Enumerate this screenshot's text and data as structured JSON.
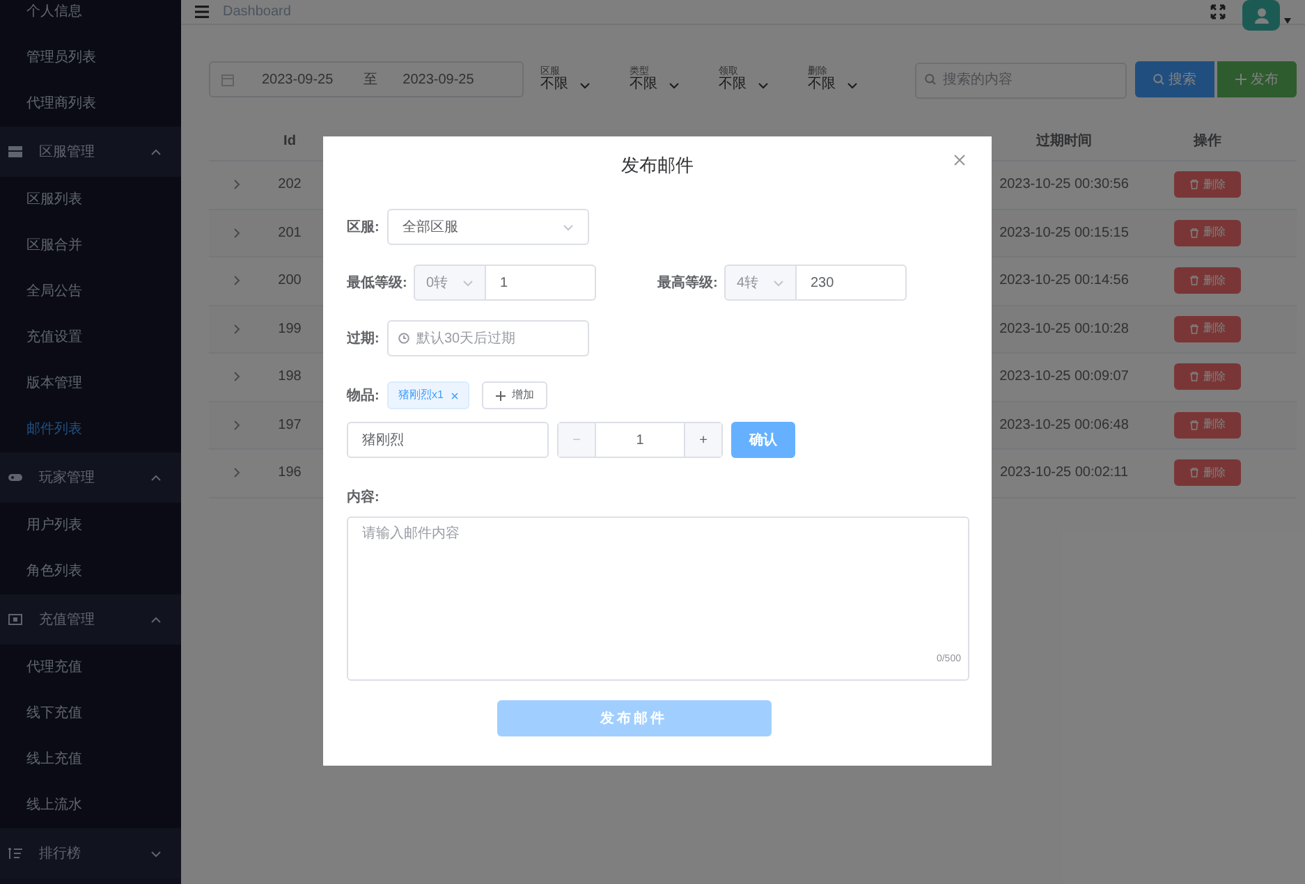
{
  "sidebar": {
    "entries": [
      {
        "kind": "item",
        "label": "个人信息",
        "selected": false
      },
      {
        "kind": "item",
        "label": "管理员列表",
        "selected": false
      },
      {
        "kind": "item",
        "label": "代理商列表",
        "selected": false
      },
      {
        "kind": "group",
        "label": "区服管理",
        "expanded": true,
        "children": [
          {
            "label": "区服列表",
            "selected": false
          },
          {
            "label": "区服合并",
            "selected": false
          },
          {
            "label": "全局公告",
            "selected": false
          },
          {
            "label": "充值设置",
            "selected": false
          },
          {
            "label": "版本管理",
            "selected": false
          },
          {
            "label": "邮件列表",
            "selected": true
          }
        ]
      },
      {
        "kind": "group",
        "label": "玩家管理",
        "expanded": true,
        "children": [
          {
            "label": "用户列表",
            "selected": false
          },
          {
            "label": "角色列表",
            "selected": false
          }
        ]
      },
      {
        "kind": "group",
        "label": "充值管理",
        "expanded": true,
        "children": [
          {
            "label": "代理充值",
            "selected": false
          },
          {
            "label": "线下充值",
            "selected": false
          },
          {
            "label": "线上充值",
            "selected": false
          },
          {
            "label": "线上流水",
            "selected": false
          }
        ]
      },
      {
        "kind": "group",
        "label": "排行榜",
        "expanded": false
      }
    ]
  },
  "header": {
    "breadcrumb": "Dashboard"
  },
  "toolbar": {
    "date_start": "2023-09-25",
    "date_separator": "至",
    "date_end": "2023-09-25",
    "filters": [
      {
        "label": "区服",
        "value": "不限"
      },
      {
        "label": "类型",
        "value": "不限"
      },
      {
        "label": "领取",
        "value": "不限"
      },
      {
        "label": "删除",
        "value": "不限"
      }
    ],
    "search_placeholder": "搜索的内容",
    "search_button": "搜索",
    "publish_button": "发布"
  },
  "table": {
    "columns": [
      "Id",
      "过期时间",
      "操作"
    ],
    "rows": [
      {
        "id": "202",
        "expires": "2023-10-25 00:30:56",
        "action": "删除"
      },
      {
        "id": "201",
        "expires": "2023-10-25 00:15:15",
        "action": "删除"
      },
      {
        "id": "200",
        "expires": "2023-10-25 00:14:56",
        "action": "删除"
      },
      {
        "id": "199",
        "expires": "2023-10-25 00:10:28",
        "action": "删除"
      },
      {
        "id": "198",
        "expires": "2023-10-25 00:09:07",
        "action": "删除"
      },
      {
        "id": "197",
        "expires": "2023-10-25 00:06:48",
        "action": "删除"
      },
      {
        "id": "196",
        "expires": "2023-10-25 00:02:11",
        "action": "删除"
      }
    ]
  },
  "dialog": {
    "title": "发布邮件",
    "server_label": "区服:",
    "server_value": "全部区服",
    "min_label": "最低等级:",
    "min_rank": "0转",
    "min_level": "1",
    "max_label": "最高等级:",
    "max_rank": "4转",
    "max_level": "230",
    "expire_label": "过期:",
    "expire_placeholder": "默认30天后过期",
    "items_label": "物品:",
    "items": [
      {
        "label": "猪刚烈x1"
      }
    ],
    "add_button": "增加",
    "item_name": "猪刚烈",
    "quantity": "1",
    "minus": "−",
    "plus": "+",
    "confirm_button": "确认",
    "content_label": "内容:",
    "content_placeholder": "请输入邮件内容",
    "counter": "0/500",
    "submit_button": "发布邮件"
  }
}
